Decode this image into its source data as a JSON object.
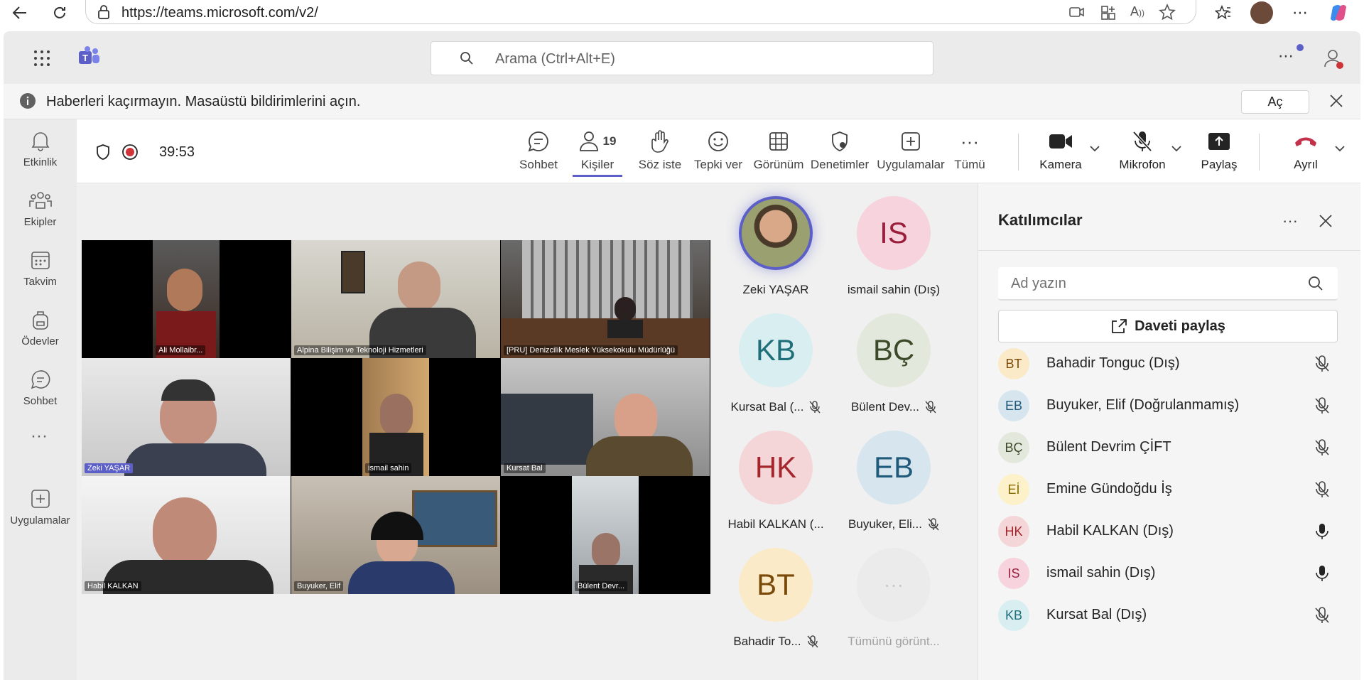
{
  "browser": {
    "url": "https://teams.microsoft.com/v2/"
  },
  "header": {
    "search_placeholder": "Arama (Ctrl+Alt+E)"
  },
  "notification": {
    "text": "Haberleri kaçırmayın. Masaüstü bildirimlerini açın.",
    "open_label": "Aç"
  },
  "rail": {
    "items": [
      {
        "label": "Etkinlik",
        "icon": "bell-icon"
      },
      {
        "label": "Ekipler",
        "icon": "teams-icon"
      },
      {
        "label": "Takvim",
        "icon": "calendar-icon"
      },
      {
        "label": "Ödevler",
        "icon": "backpack-icon"
      },
      {
        "label": "Sohbet",
        "icon": "chat-icon"
      },
      {
        "label": "Uygulamalar",
        "icon": "apps-icon"
      }
    ]
  },
  "toolbar": {
    "timer": "39:53",
    "people_count": "19",
    "items": [
      {
        "label": "Sohbet",
        "icon": "chat-icon"
      },
      {
        "label": "Kişiler",
        "icon": "people-icon"
      },
      {
        "label": "Söz iste",
        "icon": "hand-icon"
      },
      {
        "label": "Tepki ver",
        "icon": "smile-icon"
      },
      {
        "label": "Görünüm",
        "icon": "grid-icon"
      },
      {
        "label": "Denetimler",
        "icon": "shield-gear-icon"
      },
      {
        "label": "Uygulamalar",
        "icon": "plus-box-icon"
      },
      {
        "label": "Tümü",
        "icon": "more-icon"
      },
      {
        "label": "Kamera",
        "icon": "camera-icon"
      },
      {
        "label": "Mikrofon",
        "icon": "mic-off-icon"
      },
      {
        "label": "Paylaş",
        "icon": "share-icon"
      },
      {
        "label": "Ayrıl",
        "icon": "hangup-icon"
      }
    ],
    "accent": "#5b5fc7",
    "leave_color": "#c4314b"
  },
  "video_tiles": [
    {
      "name": "Ali Mollaibr..."
    },
    {
      "name": "Alpina Bilişim ve Teknoloji Hizmetleri"
    },
    {
      "name": "[PRU] Denizcilik Meslek Yüksekokulu Müdürlüğü"
    },
    {
      "name": "Zeki YAŞAR"
    },
    {
      "name": "ismail sahin"
    },
    {
      "name": "Kursat Bal"
    },
    {
      "name": "Habil KALKAN"
    },
    {
      "name": "Buyuker, Elif"
    },
    {
      "name": "Bülent Devr..."
    }
  ],
  "side_avatars": [
    {
      "initials": "",
      "name": "Zeki YAŞAR",
      "bg": "#c9a27a",
      "fg": "#3b2a1a"
    },
    {
      "initials": "IS",
      "name": "ismail sahin (Dış)",
      "bg": "#f6d3dd",
      "fg": "#9a1f3d"
    },
    {
      "initials": "KB",
      "name": "Kursat Bal (...",
      "bg": "#d9eef1",
      "fg": "#1f6f7a"
    },
    {
      "initials": "BÇ",
      "name": "Bülent Dev...",
      "bg": "#e3e8dc",
      "fg": "#3d4a2a"
    },
    {
      "initials": "HK",
      "name": "Habil KALKAN (...",
      "bg": "#f4d6d9",
      "fg": "#a4262c"
    },
    {
      "initials": "EB",
      "name": "Buyuker, Eli...",
      "bg": "#d7e6ee",
      "fg": "#205a7a"
    },
    {
      "initials": "BT",
      "name": "Bahadir To...",
      "bg": "#fbeac7",
      "fg": "#7a4a0a"
    },
    {
      "initials": "···",
      "name": "Tümünü görünt...",
      "bg": "#ebebeb",
      "fg": "#c8c8c8"
    }
  ],
  "panel": {
    "title": "Katılımcılar",
    "search_placeholder": "Ad yazın",
    "invite_label": "Daveti paylaş",
    "participants": [
      {
        "initials": "BT",
        "name": "Bahadir Tonguc (Dış)",
        "muted": true,
        "bg": "#fbeac7",
        "fg": "#7a4a0a"
      },
      {
        "initials": "EB",
        "name": "Buyuker, Elif (Doğrulanmamış)",
        "muted": true,
        "bg": "#d7e6ee",
        "fg": "#205a7a"
      },
      {
        "initials": "BÇ",
        "name": "Bülent Devrim ÇİFT",
        "muted": true,
        "bg": "#e3e8dc",
        "fg": "#3d4a2a"
      },
      {
        "initials": "Eİ",
        "name": "Emine Gündoğdu İş",
        "muted": true,
        "bg": "#fdf1c9",
        "fg": "#8a6a00"
      },
      {
        "initials": "HK",
        "name": "Habil KALKAN (Dış)",
        "muted": false,
        "bg": "#f4d6d9",
        "fg": "#a4262c"
      },
      {
        "initials": "IS",
        "name": "ismail sahin (Dış)",
        "muted": false,
        "bg": "#f6d3dd",
        "fg": "#9a1f3d"
      },
      {
        "initials": "KB",
        "name": "Kursat Bal (Dış)",
        "muted": true,
        "bg": "#d9eef1",
        "fg": "#1f6f7a"
      }
    ]
  }
}
